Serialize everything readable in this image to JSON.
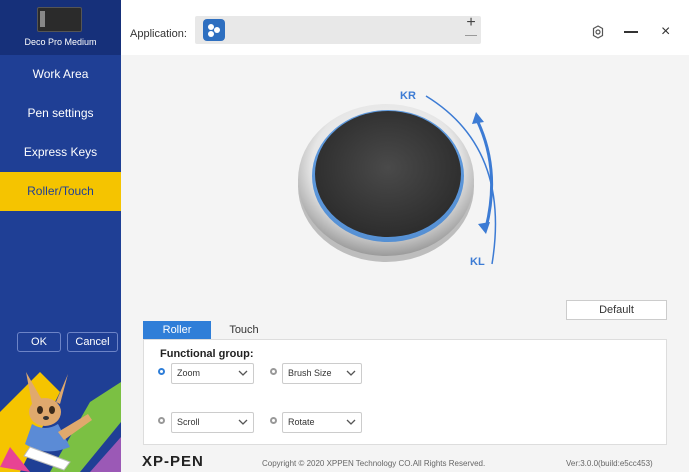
{
  "device": {
    "name": "Deco Pro Medium"
  },
  "sidebar": {
    "items": [
      {
        "label": "Work Area"
      },
      {
        "label": "Pen settings"
      },
      {
        "label": "Express Keys"
      },
      {
        "label": "Roller/Touch",
        "active": true
      }
    ],
    "ok_label": "OK",
    "cancel_label": "Cancel"
  },
  "header": {
    "application_label": "Application:",
    "add_icon": "plus-icon",
    "remove_icon": "minus-icon",
    "settings_icon": "gear-icon",
    "close_label": "×"
  },
  "roller": {
    "kr_label": "KR",
    "kl_label": "KL"
  },
  "default_label": "Default",
  "tabs": [
    {
      "label": "Roller",
      "active": true
    },
    {
      "label": "Touch",
      "active": false
    }
  ],
  "functional_group": {
    "title": "Functional group:",
    "options": [
      {
        "selected": true,
        "primary": "Zoom",
        "secondary": "Brush Size"
      },
      {
        "selected": false,
        "primary": "Scroll",
        "secondary": "Rotate"
      }
    ]
  },
  "footer": {
    "logo": "XP-PEN",
    "copyright": "Copyright © 2020 XPPEN Technology CO.All Rights Reserved.",
    "version": "Ver:3.0.0(build:e5cc453)"
  },
  "colors": {
    "sidebar": "#1f3f95",
    "active_item": "#f5c400",
    "accent": "#2f7ed8",
    "roller_ring": "#3c7bd4"
  }
}
